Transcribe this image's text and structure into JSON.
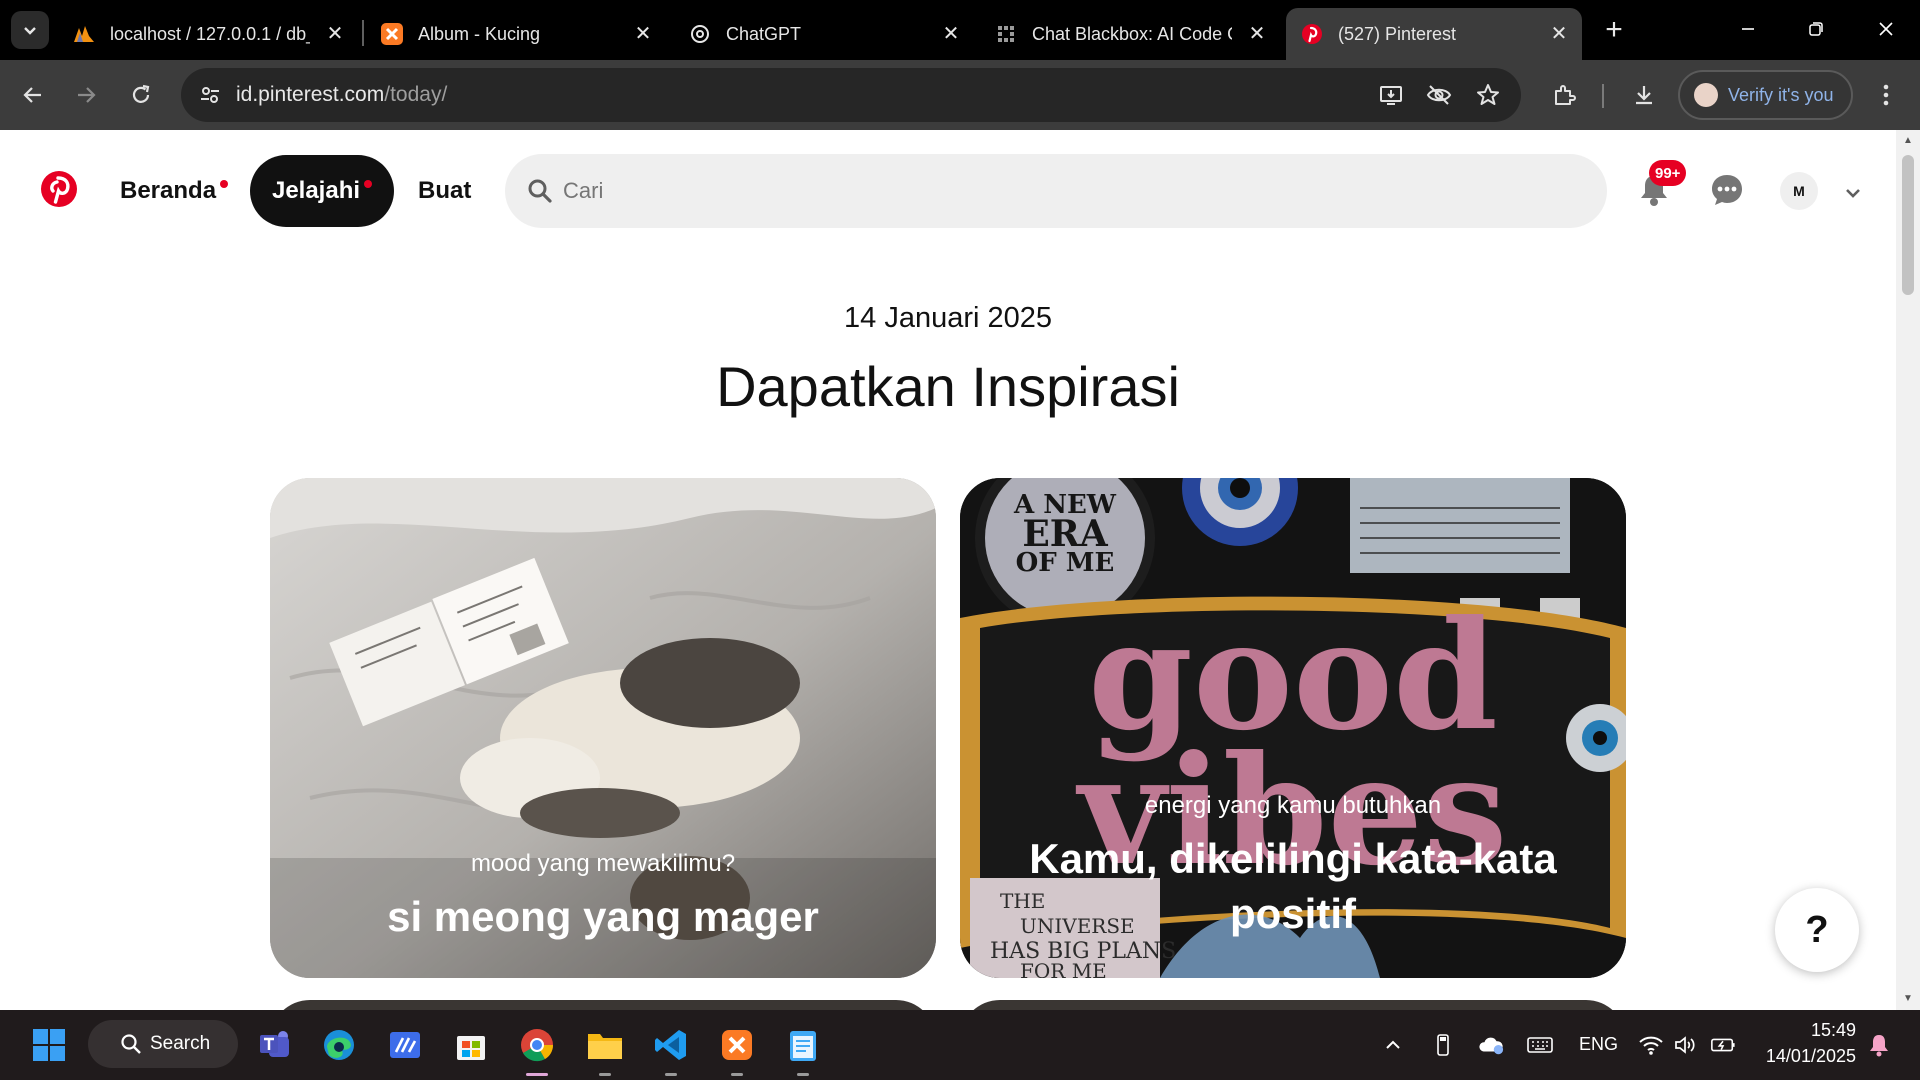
{
  "browser": {
    "tabs": [
      {
        "title": "localhost / 127.0.0.1 / db_",
        "favicon": "phpmyadmin-icon"
      },
      {
        "title": "Album - Kucing",
        "favicon": "xampp-icon"
      },
      {
        "title": "ChatGPT",
        "favicon": "chatgpt-icon"
      },
      {
        "title": "Chat Blackbox: AI Code G",
        "favicon": "blackbox-icon"
      },
      {
        "title": "(527) Pinterest",
        "favicon": "pinterest-icon",
        "active": true
      }
    ],
    "address": {
      "host": "id.pinterest.com",
      "path": "/today/"
    },
    "profile_button": "Verify it's you"
  },
  "header": {
    "nav": {
      "home": "Beranda",
      "explore": "Jelajahi",
      "create": "Buat"
    },
    "search": {
      "placeholder": "Cari"
    },
    "notification_badge": "99+",
    "avatar_initial": "M"
  },
  "main": {
    "date": "14 Januari 2025",
    "headline": "Dapatkan Inspirasi",
    "cards": [
      {
        "subtitle": "mood yang mewakilimu?",
        "title": "si meong yang mager"
      },
      {
        "subtitle": "energi yang kamu butuhkan",
        "title": "Kamu, dikelilingi kata-kata positif"
      }
    ],
    "help_label": "?"
  },
  "taskbar": {
    "search_label": "Search",
    "language": "ENG",
    "time": "15:49",
    "date": "14/01/2025"
  },
  "colors": {
    "pinterest_red": "#e60023",
    "chrome_dark": "#3c3c3c",
    "taskbar": "#201b1c"
  }
}
